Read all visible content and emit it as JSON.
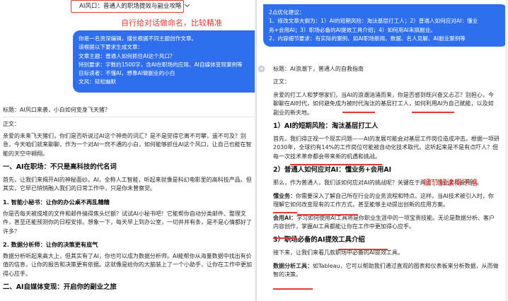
{
  "left": {
    "conversation_title": "AI风口：普通人的职场提效与副业攻略",
    "annotation_title": "自行给对话做命名，比较精准",
    "user_message_lines": [
      "你是一名资深编辑，擅长根据不同主题创作文章。",
      "请根据以下要求生成文章：",
      "文章主题：普通人如何抓住AI这个风口？",
      "特别要求：字数约1500字，含AI在职场的应用、AI自媒体变现案例等",
      "目标读者：不懂AI，想靠AI做副业的小白",
      "文风：轻松幽默"
    ],
    "article_title": "标题：AI风口来袭，小白如何变身飞天猪？",
    "body_label": "正文：",
    "intro": [
      "亲爱的未来飞天猪们，你们是否听说过AI这个神奇的词汇？是不是觉得它离不可攀，遥不可及？别",
      "急，今天咱们就来聊聊，作为一个对AI一窍不通的小白，如何能够抓住AI这个风口，让自己也能在智",
      "能的天空中翱翔。"
    ],
    "section1_heading": "一、AI在职场：不只是高科技的代名词",
    "section1_text": [
      "首先，让我们来揭开AI的神秘面纱。AI，全称人工智能，听起来就像是科幻电影里的高科技产品。但",
      "其实，它早已悄悄融入我们的日常工作中，只是你未曾察觉。"
    ],
    "sub1_heading": "1. 智能小秘书：让你的办公桌不再乱糟糟",
    "sub1_text": [
      "你是否每天被成堆的文件和邮件搞得焦头烂额？试试AI小秘书吧！它能帮你自动分类邮件、整理文",
      "件，甚至还能预测你的日程安排。想象一下，每天早上到办公室，一切井井有条，是不是心情都好了",
      "许多？"
    ],
    "sub2_heading": "2. 数据分析师：让你的决策更有底气",
    "sub2_text": [
      "数据分析听起来高大上，但其实有了AI，你也可以成为数据分析师。AI能帮你从海量数据中找出有价",
      "值的信息，让你的报告和决策更有依据。这就像是给你的大脑装上了一个小助手，让你在工作中更加",
      "得心应手。"
    ],
    "section2_heading": "二、AI自媒体变现：开启你的副业之旅"
  },
  "right": {
    "assistant_prefix_lines": [
      "2点优化建议：",
      "1、修改文章大纲为：1）AI的短期风险：淘汰基层打工人；2）普通人如何应对AI：懂业",
      "务+会用AI；3）职场必备的AI提效工具介绍；4）如何用AI来搞副业。",
      "2、内容细节要求：有实际的案例、如AI职场新闻、数据、名人见解、AI副业案例等"
    ],
    "article_title": "标题：AI浪潮下，普通人的自救指南",
    "body_label": "正文：",
    "intro": [
      "亲爱的打工人和梦想家们，当AI的浪潮汹涌而来，你是否感到既兴奋又忐忑？别担心，今",
      "聊聊在AI时代，如何避免成为被时代淘汰的基层打工人，如何利用AI为自己赋能，以及如",
      "副业的新天地。"
    ],
    "section1_heading": "1）AI的短期风险：淘汰基层打工人",
    "section1_text": [
      "首先，我们得正视一个现实问题——AI的发展可能会对基层工作岗位造成冲击。根据一项研",
      "2030年，全球约有14%的工作岗位可能被自动化技术取代。这听起来是不是有点吓人？但",
      "每一次技术革命都会带来新的机遇和挑战。"
    ],
    "annotation_detail": "细节解读得不错",
    "section2_heading": "2）普通人如何应对AI：懂业务+会用AI",
    "section2_intro": "那么，作为普通人，我们该如何应对AI的挑战呢？关键在于两点：懂业务和会用AI。",
    "biz_label": "懂业务：",
    "biz_text": [
      "你需要深入了解自己所在行业的业务流程和特点。这样，当AI技术被引入时，你",
      "理解它如何改变现有的工作方式，甚至能够主动提出创新的应用方案。"
    ],
    "ai_label": "会用AI：",
    "ai_text": [
      "学习如何使用AI工具将是你职业生涯中的一项宝贵技能。无论是数据分析、客户",
      "内容创作，掌握AI工具都能让你在工作中更加得心应手。"
    ],
    "section3_heading": "3）职场必备的AI提效工具介绍",
    "section3_intro": "接下来，让我们来看几款职场中必备的AI提效工具。",
    "tool_label": "数据分析工具：",
    "tool_text": [
      "如Tableau，它可以帮助我们通过直观的图表和仪表板来分析数据，从而做",
      "智的决策。"
    ]
  }
}
